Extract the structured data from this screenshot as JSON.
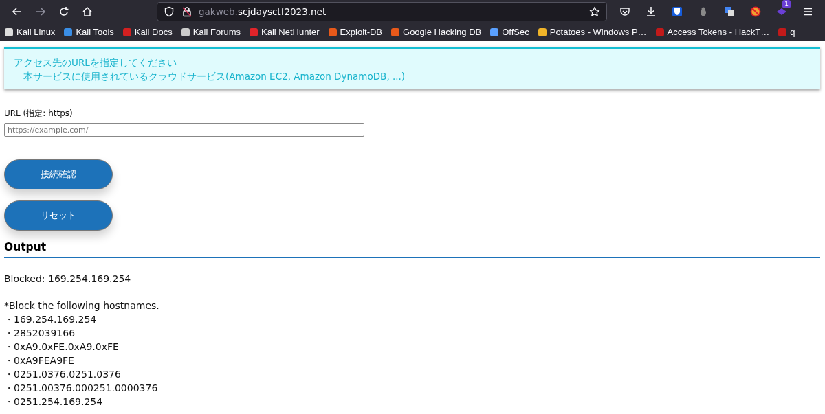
{
  "browser": {
    "address": {
      "subdomain": "gakweb.",
      "domain": "scjdaysctf2023.net"
    },
    "extension_badge": "1",
    "bookmarks": [
      "Kali Linux",
      "Kali Tools",
      "Kali Docs",
      "Kali Forums",
      "Kali NetHunter",
      "Exploit-DB",
      "Google Hacking DB",
      "OffSec",
      "Potatoes - Windows P…",
      "Access Tokens - HackT…",
      "q"
    ]
  },
  "notice": {
    "lines": [
      "アクセス先のURLを指定してください",
      "本サービスに使用されているクラウドサービス(Amazon EC2, Amazon DynamoDB, ...)"
    ]
  },
  "form": {
    "label": "URL (指定: https)",
    "placeholder": "https://example.com/",
    "buttons": [
      "接続確認",
      "リセット"
    ]
  },
  "output": {
    "heading": "Output",
    "result": "Blocked: 169.254.169.254",
    "note": "*Block the following hostnames.",
    "hostnames": [
      "・169.254.169.254",
      "・2852039166",
      "・0xA9.0xFE.0xA9.0xFE",
      "・0xA9FEA9FE",
      "・0251.0376.0251.0376",
      "・0251.00376.000251.0000376",
      "・0251.254.169.254"
    ]
  }
}
